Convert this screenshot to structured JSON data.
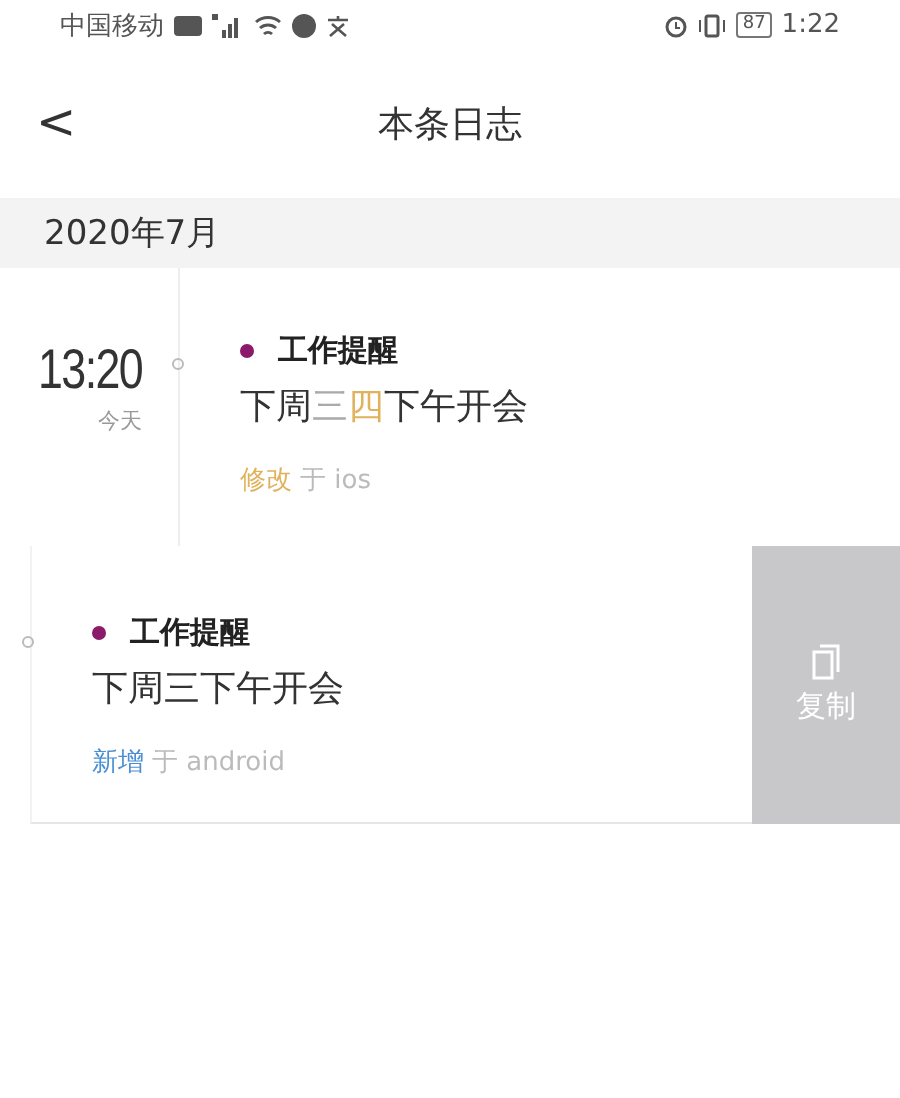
{
  "status_bar": {
    "carrier": "中国移动",
    "battery": "87",
    "time": "1:22"
  },
  "header": {
    "back": "<",
    "title": "本条日志"
  },
  "month": "2020年7月",
  "entries": [
    {
      "time": "13:20",
      "day": "今天",
      "swiped": false,
      "tag": {
        "label": "工作提醒",
        "color": "#8b1a6b"
      },
      "segments": [
        {
          "text": "下周",
          "kind": "same"
        },
        {
          "text": "三",
          "kind": "removed"
        },
        {
          "text": "四",
          "kind": "added"
        },
        {
          "text": "下午开会",
          "kind": "same"
        }
      ],
      "action": {
        "label": "修改",
        "color": "#e0b25c"
      },
      "via": "于 ios"
    },
    {
      "swiped": true,
      "tag": {
        "label": "工作提醒",
        "color": "#8b1a6b"
      },
      "segments": [
        {
          "text": "下周三下午开会",
          "kind": "same"
        }
      ],
      "action": {
        "label": "新增",
        "color": "#4a8fd4"
      },
      "via": "于 android",
      "copy": "复制"
    }
  ]
}
